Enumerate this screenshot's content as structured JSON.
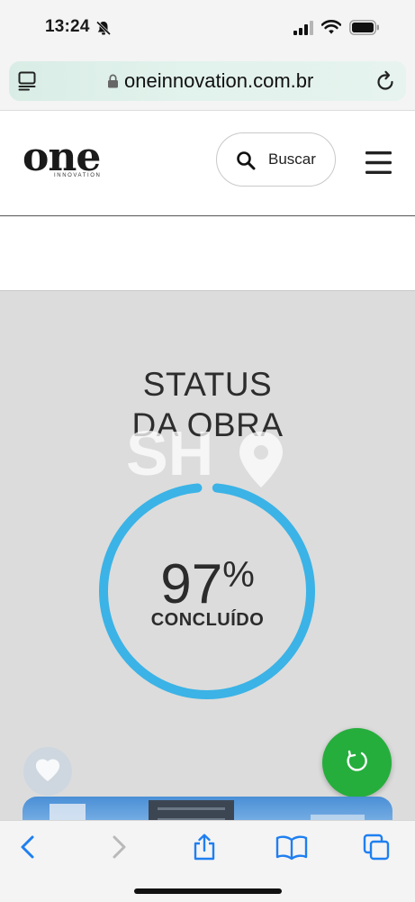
{
  "status_bar": {
    "time": "13:24"
  },
  "browser": {
    "url": "oneinnovation.com.br"
  },
  "site_header": {
    "logo_text": "one",
    "logo_subtext": "INNOVATION",
    "search_label": "Buscar"
  },
  "status_section": {
    "title_line1": "STATUS",
    "title_line2": "DA OBRA",
    "percent_value": "97",
    "percent_sign": "%",
    "progress_fraction": 0.97,
    "completed_label": "CONCLUÍDO",
    "watermark_text": "SH"
  },
  "colors": {
    "progress": "#3bb3e6",
    "chat_button": "#25ae3c",
    "section_bg": "#dcdcdc",
    "url_bar": "#dff0ea"
  },
  "icons": {
    "status_bar": [
      "bell-off-icon",
      "signal-icon",
      "wifi-icon",
      "battery-icon"
    ],
    "browser": [
      "reader-icon",
      "lock-icon",
      "reload-icon"
    ],
    "header": [
      "search-icon",
      "menu-icon"
    ],
    "floating": [
      "accessibility-icon",
      "chat-icon"
    ],
    "toolbar": [
      "back-icon",
      "forward-icon",
      "share-icon",
      "bookmarks-icon",
      "tabs-icon"
    ]
  }
}
